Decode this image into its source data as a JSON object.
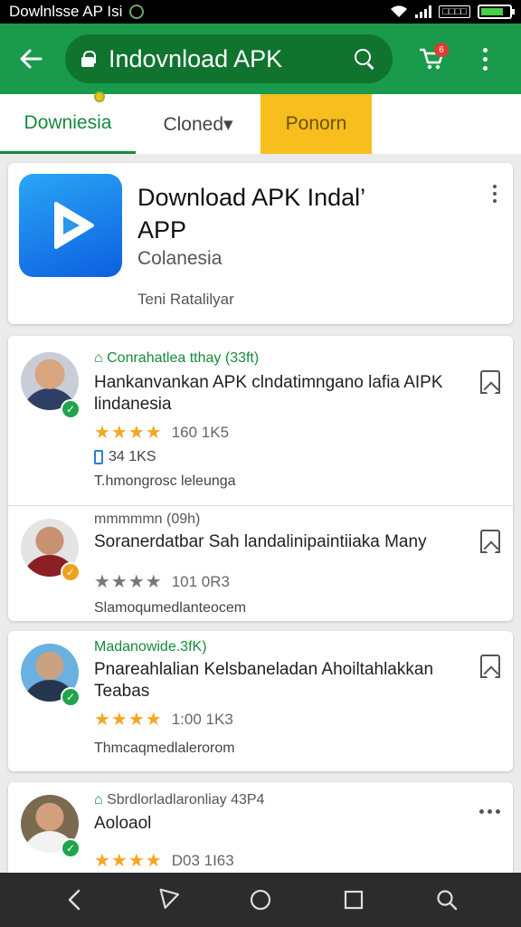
{
  "status_bar": {
    "title": "Dowlnlsse AP Isi",
    "badge": "□□□□"
  },
  "app_bar": {
    "search_text": "Indovnload APK",
    "cart_badge": "6"
  },
  "tabs": [
    {
      "label": "Downiesia"
    },
    {
      "label": "Cloned▾"
    },
    {
      "label": "Ponorn"
    }
  ],
  "hero": {
    "title": "Download APK Indal’ APP",
    "subtitle": "Colanesia",
    "developer": "Teni Ratalilyar"
  },
  "reviews": [
    {
      "meta": "Conrahatlea tthay (33ft)",
      "title": "Hankanvankan APK clndatimngano lafia AIPK lindanesia",
      "stars": "★★★★",
      "rating": "160  1K5",
      "extra": "34  1KS",
      "footer": "T.hmongrosc leleunga"
    },
    {
      "meta": "mmmmmn (09h)",
      "title": "Soranerdatbar Sah landalinipaintiiaka Many",
      "stars": "★★★★",
      "rating": "101  0R3",
      "footer": "Slamoqumedlanteocem"
    },
    {
      "meta": "Madanowide.3fK)",
      "title": "Pnareahlalian Kelsbaneladan Ahoiltahlakkan Teabas",
      "stars": "★★★★",
      "rating": "1:00  1K3",
      "footer": "Thmcaqmedlalerorom"
    },
    {
      "meta": "Sbrdlorladlaronliay 43P4",
      "title": "Aoloaol",
      "stars": "★★★★",
      "rating": "D03  1I63"
    }
  ],
  "colors": {
    "primary": "#1a9a4c",
    "accent": "#f7be1d",
    "star": "#f5a623"
  }
}
